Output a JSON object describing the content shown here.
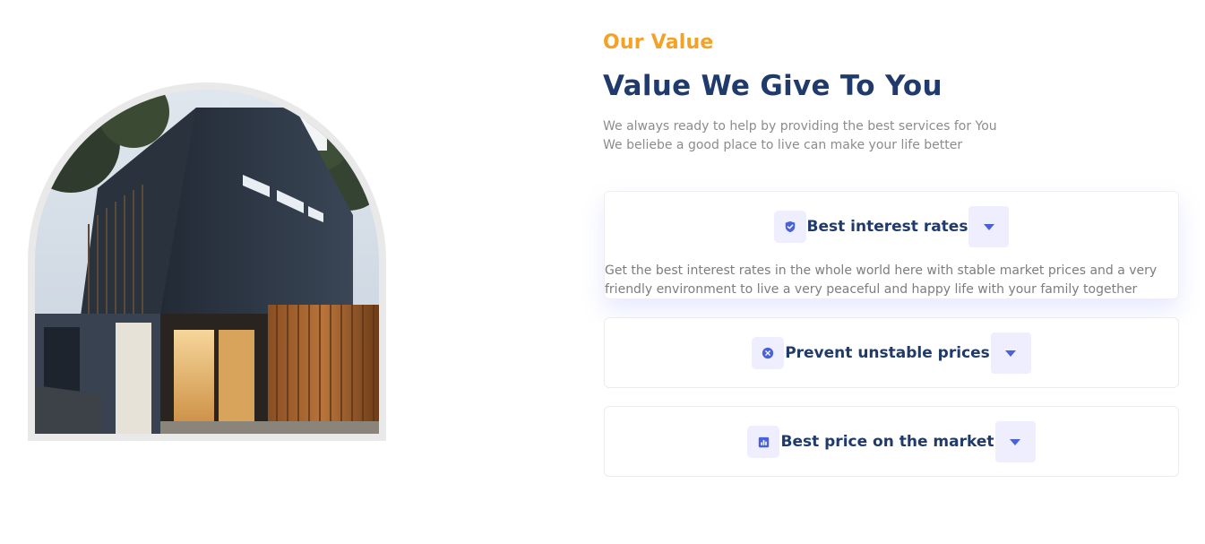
{
  "section": {
    "eyebrow": "Our Value",
    "title": "Value We Give To You",
    "description_lines": [
      "We always ready to help by providing the best services for You",
      "We beliebe a good place to live can make your life better"
    ]
  },
  "accordion": {
    "items": [
      {
        "icon": "shield-check-icon",
        "title": "Best interest rates",
        "expanded": true,
        "body": "Get the best interest rates in the whole world here with stable market prices and a very friendly environment to live a very peaceful and happy life with your family together"
      },
      {
        "icon": "close-circle-icon",
        "title": "Prevent unstable prices",
        "expanded": false
      },
      {
        "icon": "chart-icon",
        "title": "Best price on the market",
        "expanded": false
      }
    ]
  },
  "colors": {
    "accent_orange": "#f2a129",
    "heading_navy": "#1f3a6b",
    "icon_blue": "#4a62d8",
    "icon_bg": "#eeeeff",
    "body_gray": "#8c8c8c"
  },
  "image": {
    "subject": "house-photo"
  }
}
